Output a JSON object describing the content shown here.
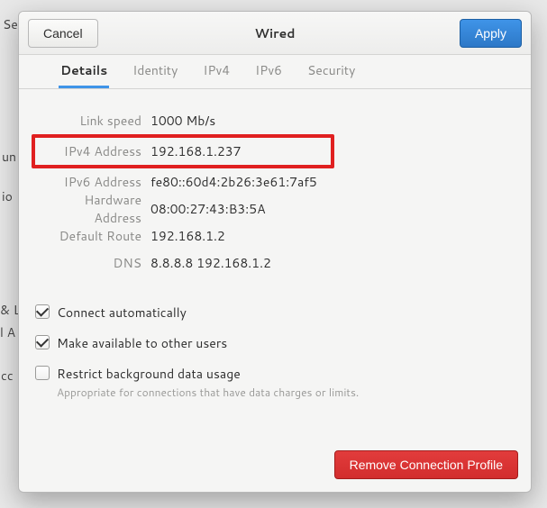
{
  "header": {
    "cancel": "Cancel",
    "title": "Wired",
    "apply": "Apply"
  },
  "tabs": [
    {
      "label": "Details",
      "active": true
    },
    {
      "label": "Identity",
      "active": false
    },
    {
      "label": "IPv4",
      "active": false
    },
    {
      "label": "IPv6",
      "active": false
    },
    {
      "label": "Security",
      "active": false
    }
  ],
  "details": [
    {
      "label": "Link speed",
      "value": "1000 Mb/s",
      "highlighted": false
    },
    {
      "label": "IPv4 Address",
      "value": "192.168.1.237",
      "highlighted": true
    },
    {
      "label": "IPv6 Address",
      "value": "fe80::60d4:2b26:3e61:7af5",
      "highlighted": false
    },
    {
      "label": "Hardware Address",
      "value": "08:00:27:43:B3:5A",
      "highlighted": false
    },
    {
      "label": "Default Route",
      "value": "192.168.1.2",
      "highlighted": false
    },
    {
      "label": "DNS",
      "value": "8.8.8.8 192.168.1.2",
      "highlighted": false
    }
  ],
  "checks": {
    "connect_auto": {
      "label": "Connect automatically",
      "checked": true
    },
    "available_others": {
      "label": "Make available to other users",
      "checked": true
    },
    "restrict_bg": {
      "label": "Restrict background data usage",
      "sub": "Appropriate for connections that have data charges or limits.",
      "checked": false
    }
  },
  "footer": {
    "remove": "Remove Connection Profile"
  }
}
